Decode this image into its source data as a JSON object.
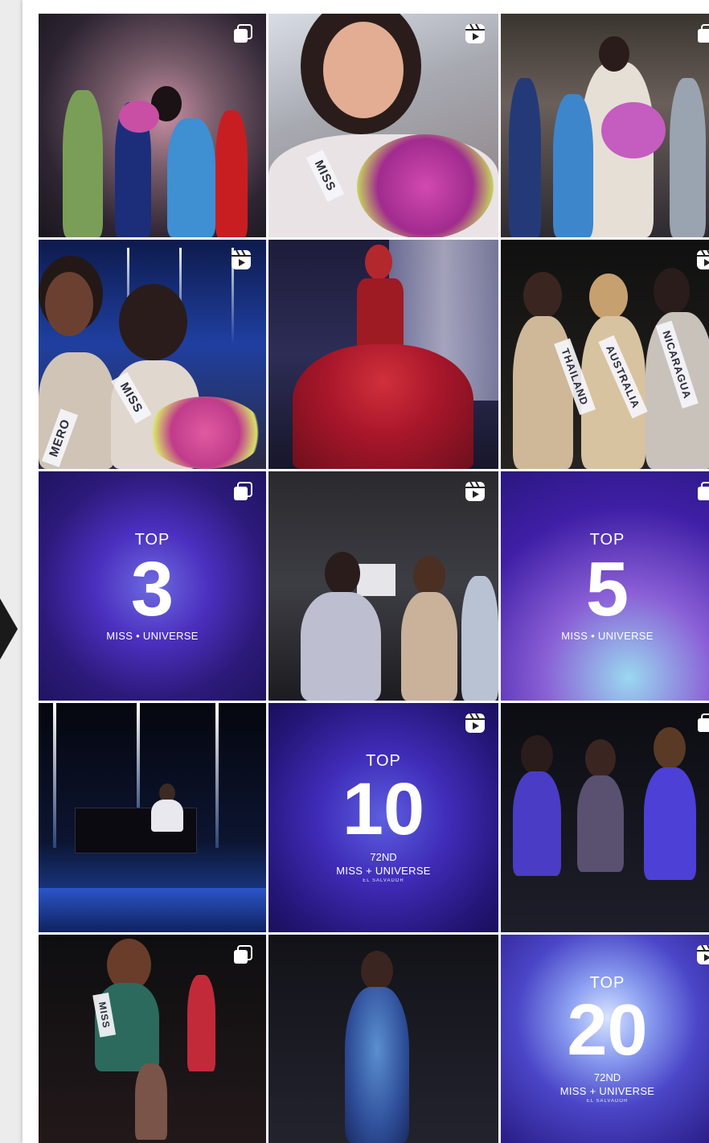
{
  "colors": {
    "promo_purple": "#3a1f9a",
    "badge_white": "#ffffff"
  },
  "badges": {
    "carousel": "carousel-icon",
    "reel": "reel-icon"
  },
  "posts": [
    {
      "type": "photo",
      "badge": "carousel-icon"
    },
    {
      "type": "photo",
      "badge": "reel-icon"
    },
    {
      "type": "photo",
      "badge": "carousel-icon"
    },
    {
      "type": "photo",
      "badge": "reel-icon"
    },
    {
      "type": "photo",
      "badge": "none"
    },
    {
      "type": "photo",
      "badge": "reel-icon",
      "sashes": [
        "THAILAND",
        "AUSTRALIA",
        "NICARAGUA"
      ]
    },
    {
      "type": "promo",
      "badge": "carousel-icon",
      "top": "TOP",
      "number": "3",
      "brand": "MISS • UNIVERSE"
    },
    {
      "type": "photo",
      "badge": "reel-icon"
    },
    {
      "type": "promo",
      "badge": "carousel-icon",
      "top": "TOP",
      "number": "5",
      "brand": "MISS • UNIVERSE"
    },
    {
      "type": "photo",
      "badge": "none"
    },
    {
      "type": "promo",
      "badge": "reel-icon",
      "top": "TOP",
      "number": "10",
      "edition": "72ND",
      "brand": "MISS + UNIVERSE",
      "sub": "EL SALVADOR"
    },
    {
      "type": "photo",
      "badge": "carousel-icon"
    },
    {
      "type": "photo",
      "badge": "carousel-icon",
      "sashes": [
        "MISS"
      ]
    },
    {
      "type": "photo",
      "badge": "none"
    },
    {
      "type": "promo",
      "badge": "reel-icon",
      "top": "TOP",
      "number": "20",
      "edition": "72ND",
      "brand": "MISS + UNIVERSE",
      "sub": "EL SALVADOR"
    }
  ],
  "tile2": {
    "sash": "MISS"
  },
  "tile4": {
    "sash1": "MISS",
    "sash2": "MERO"
  }
}
